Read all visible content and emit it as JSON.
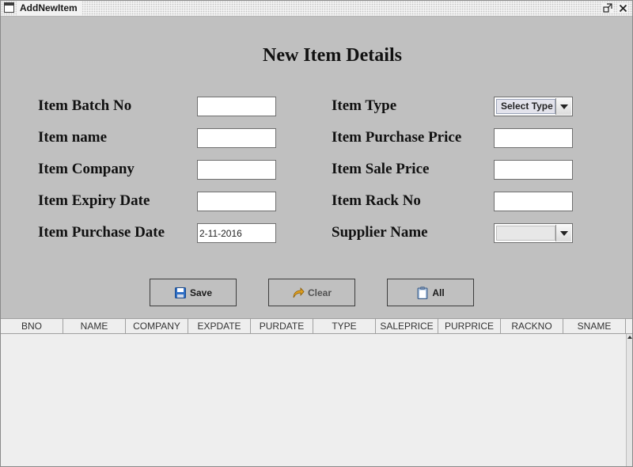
{
  "window": {
    "title": "AddNewItem"
  },
  "form": {
    "heading": "New Item Details",
    "left_fields": [
      {
        "label": "Item Batch No",
        "value": ""
      },
      {
        "label": "Item name",
        "value": ""
      },
      {
        "label": "Item Company",
        "value": ""
      },
      {
        "label": "Item Expiry Date",
        "value": ""
      },
      {
        "label": "Item Purchase Date",
        "value": "2-11-2016"
      }
    ],
    "right_fields": {
      "item_type": {
        "label": "Item Type",
        "selected": "Select Type"
      },
      "purchase_price": {
        "label": "Item Purchase Price",
        "value": ""
      },
      "sale_price": {
        "label": "Item Sale Price",
        "value": ""
      },
      "rack_no": {
        "label": "Item Rack No",
        "value": ""
      },
      "supplier": {
        "label": "Supplier Name",
        "selected": ""
      }
    }
  },
  "buttons": {
    "save": {
      "label": "Save",
      "icon": "floppy-disk-icon"
    },
    "clear": {
      "label": "Clear",
      "icon": "curved-arrow-icon"
    },
    "all": {
      "label": "All",
      "icon": "clipboard-icon"
    }
  },
  "table": {
    "columns": [
      "BNO",
      "NAME",
      "COMPANY",
      "EXPDATE",
      "PURDATE",
      "TYPE",
      "SALEPRICE",
      "PURPRICE",
      "RACKNO",
      "SNAME"
    ],
    "rows": []
  },
  "colors": {
    "panel_bg": "#c0c0c0",
    "window_bg": "#eeeeee",
    "save_icon": "#2f6fc6",
    "clear_icon": "#e0a020"
  }
}
